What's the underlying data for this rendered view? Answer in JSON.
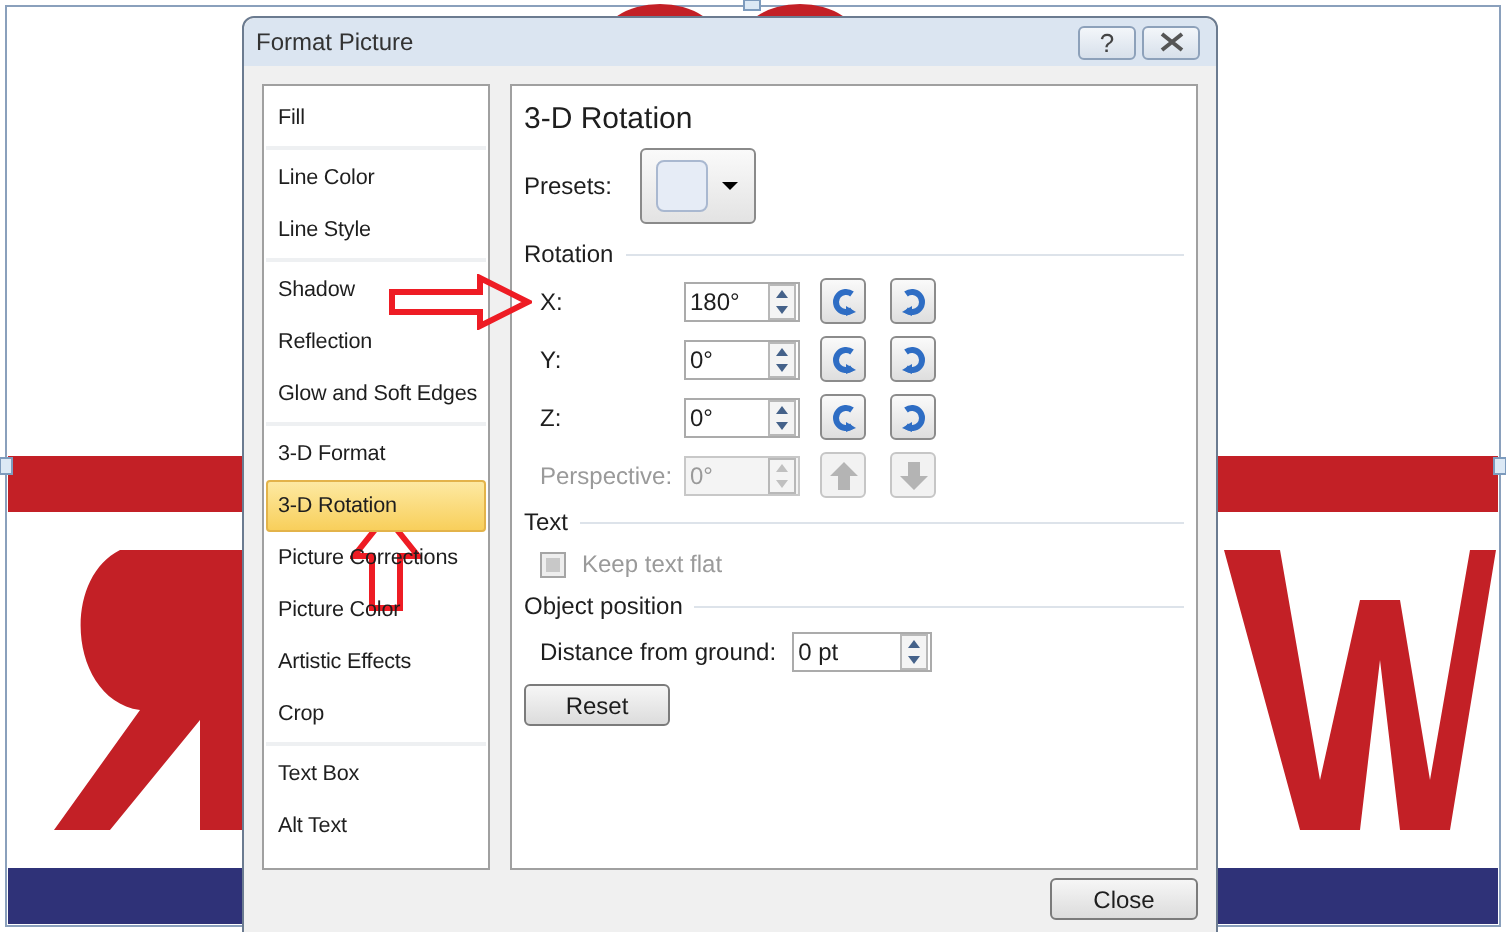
{
  "window": {
    "title": "Format Picture",
    "help_label": "?"
  },
  "categories": [
    [
      {
        "label": "Fill",
        "selected": false
      }
    ],
    [
      {
        "label": "Line Color",
        "selected": false
      },
      {
        "label": "Line Style",
        "selected": false
      }
    ],
    [
      {
        "label": "Shadow",
        "selected": false
      },
      {
        "label": "Reflection",
        "selected": false
      },
      {
        "label": "Glow and Soft Edges",
        "selected": false
      }
    ],
    [
      {
        "label": "3-D Format",
        "selected": false
      },
      {
        "label": "3-D Rotation",
        "selected": true
      },
      {
        "label": "Picture Corrections",
        "selected": false
      },
      {
        "label": "Picture Color",
        "selected": false
      },
      {
        "label": "Artistic Effects",
        "selected": false
      },
      {
        "label": "Crop",
        "selected": false
      }
    ],
    [
      {
        "label": "Text Box",
        "selected": false
      },
      {
        "label": "Alt Text",
        "selected": false
      }
    ]
  ],
  "panel": {
    "heading": "3-D Rotation",
    "presets_label": "Presets:",
    "rotation_section": "Rotation",
    "rotation": [
      {
        "label": "X:",
        "value": "180°",
        "disabled": false,
        "kind": "x"
      },
      {
        "label": "Y:",
        "value": "0°",
        "disabled": false,
        "kind": "y"
      },
      {
        "label": "Z:",
        "value": "0°",
        "disabled": false,
        "kind": "z"
      },
      {
        "label": "Perspective:",
        "value": "0°",
        "disabled": true,
        "kind": "perspective"
      }
    ],
    "text_section": "Text",
    "keep_text_flat": {
      "label": "Keep text flat",
      "checked": false,
      "disabled": true
    },
    "object_section": "Object position",
    "distance": {
      "label": "Distance from ground:",
      "value": "0 pt"
    },
    "reset": "Reset"
  },
  "close": "Close"
}
